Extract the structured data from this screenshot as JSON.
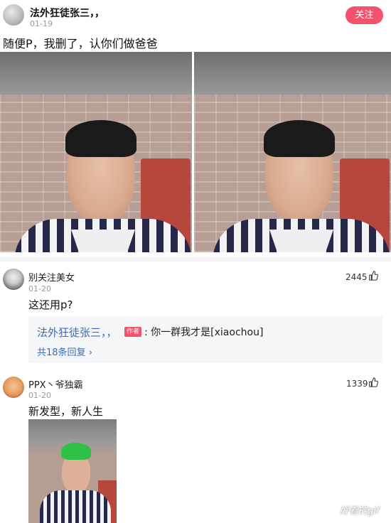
{
  "post": {
    "author": "法外狂徒张三，，",
    "date": "01-19",
    "follow_label": "关注",
    "text": "随便P，我删了，认你们做爸爸"
  },
  "comments": [
    {
      "name": "别关注美女",
      "date": "01-20",
      "likes": "2445",
      "text": "这还用p?",
      "reply": {
        "author": "法外狂徒张三，，",
        "tag": "作者",
        "text": ": 你一群我才是[xiaochou]",
        "count_label": "共18条回复"
      }
    },
    {
      "name": "PPX丶爷独霸",
      "date": "01-20",
      "likes": "1339",
      "text": "新发型，新人生"
    }
  ],
  "watermark": "好看的gif",
  "colors": {
    "accent": "#f4516c",
    "link": "#3f6cb0",
    "reply_bg": "#f5f6f8"
  },
  "icons": [
    "thumbs-up-icon",
    "chevron-right-icon"
  ]
}
